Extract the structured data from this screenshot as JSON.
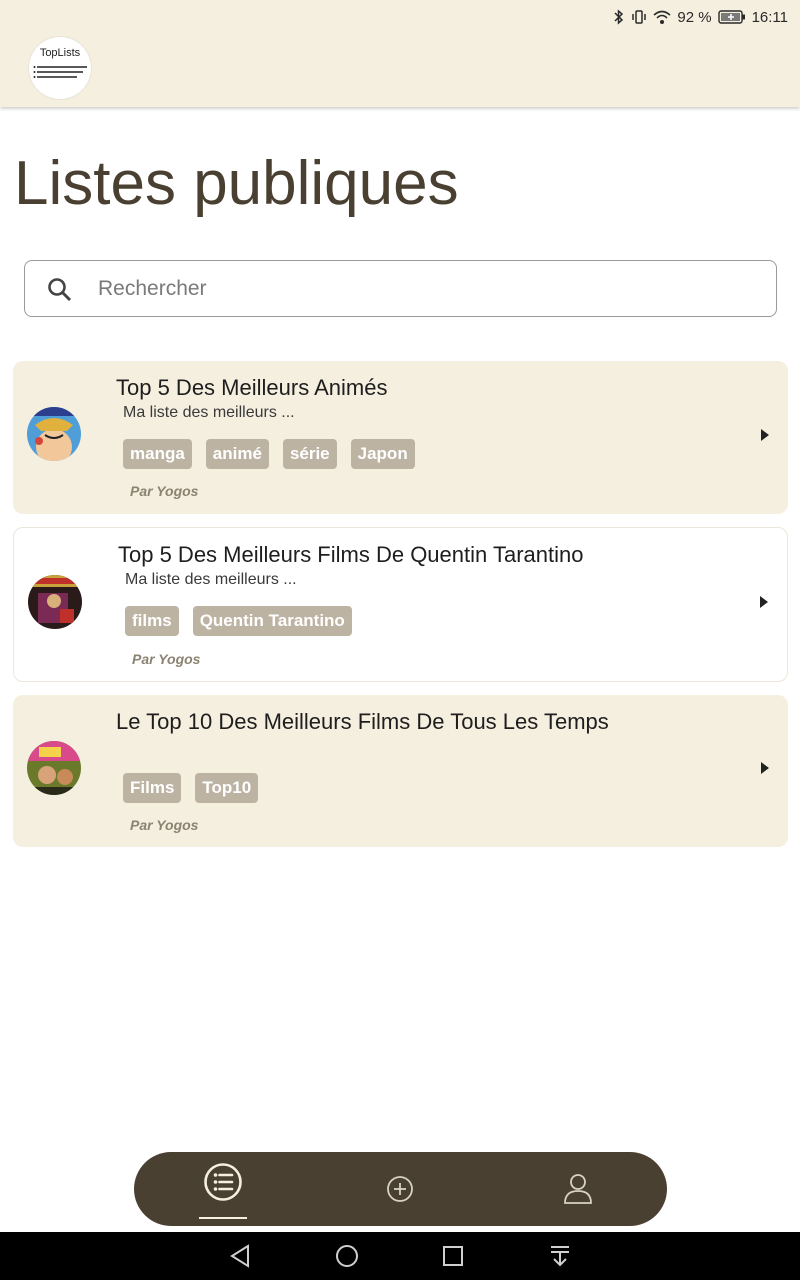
{
  "status_bar": {
    "battery": "92 %",
    "time": "16:11",
    "icons": [
      "bluetooth-icon",
      "vibrate-icon",
      "wifi-icon",
      "battery-icon"
    ]
  },
  "header": {
    "logo_text": "TopLists"
  },
  "page": {
    "title": "Listes publiques"
  },
  "search": {
    "placeholder": "Rechercher",
    "value": ""
  },
  "lists": [
    {
      "title": "Top 5 Des Meilleurs Animés",
      "description": "Ma liste des meilleurs ...",
      "tags": [
        "manga",
        "animé",
        "série",
        "Japon"
      ],
      "author": "Par Yogos"
    },
    {
      "title": "Top 5 Des Meilleurs Films De Quentin Tarantino",
      "description": "Ma liste des meilleurs ...",
      "tags": [
        "films",
        "Quentin Tarantino"
      ],
      "author": "Par Yogos"
    },
    {
      "title": "Le Top 10 Des Meilleurs Films De Tous Les Temps",
      "description": "",
      "tags": [
        "Films",
        "Top10"
      ],
      "author": "Par Yogos"
    }
  ],
  "bottom_nav": {
    "items": [
      "list-icon",
      "add-circle-icon",
      "user-icon"
    ],
    "active": "list-icon"
  },
  "colors": {
    "header_bg": "#f5efe0",
    "accent_dark": "#4a4032",
    "tag_bg": "#bdb3a3",
    "author_text": "#8b8272"
  }
}
